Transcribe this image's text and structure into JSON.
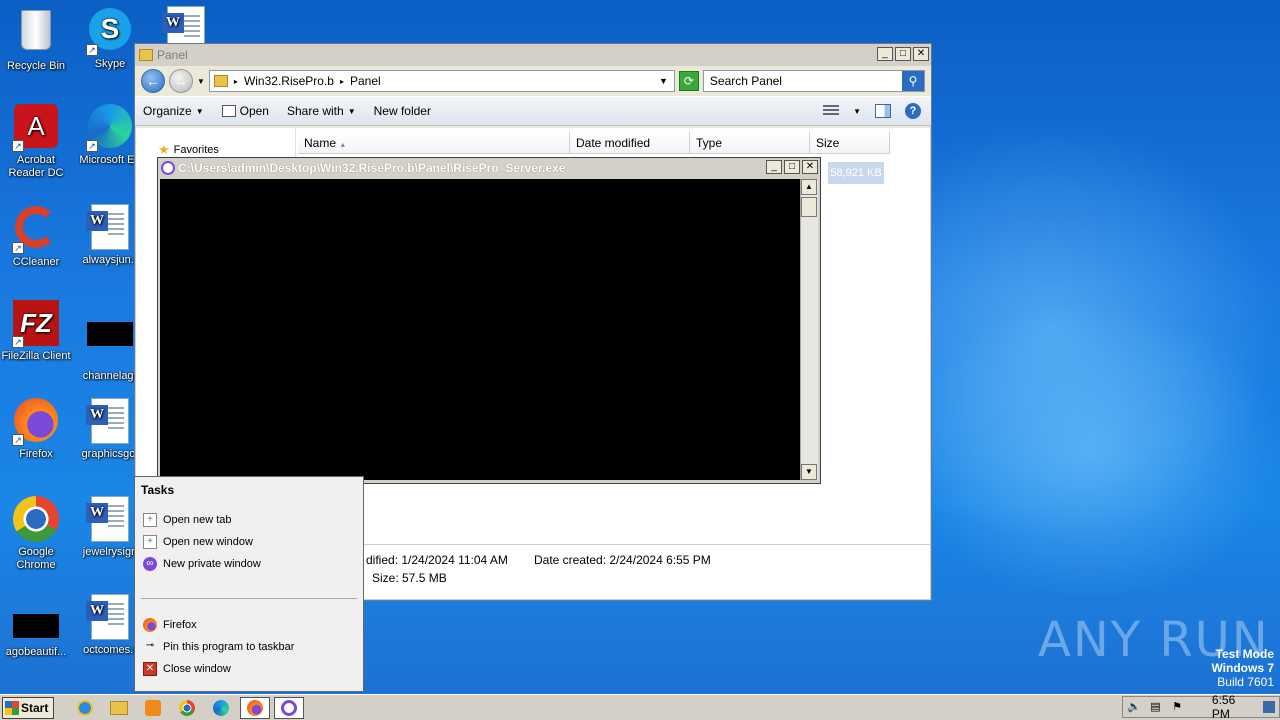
{
  "desktop": {
    "icons": [
      {
        "label": "Recycle Bin"
      },
      {
        "label": "Skype"
      },
      {
        "label": "Acrobat Reader DC"
      },
      {
        "label": "Microsoft Ed"
      },
      {
        "label": "CCleaner"
      },
      {
        "label": "alwaysjun.r"
      },
      {
        "label": "FileZilla Client"
      },
      {
        "label": "channelagr"
      },
      {
        "label": "Firefox"
      },
      {
        "label": "graphicsgot"
      },
      {
        "label": "Google Chrome"
      },
      {
        "label": "jewelrysign"
      },
      {
        "label": "agobeautif..."
      },
      {
        "label": "octcomes.r"
      }
    ]
  },
  "explorer": {
    "title": "Panel",
    "breadcrumb": [
      "Win32.RisePro.b",
      "Panel"
    ],
    "search_placeholder": "Search Panel",
    "toolbar": {
      "organize": "Organize",
      "open": "Open",
      "share_with": "Share with",
      "new_folder": "New folder"
    },
    "nav": {
      "favorites": "Favorites"
    },
    "columns": [
      "Name",
      "Date modified",
      "Type",
      "Size"
    ],
    "selected_size": "58,921 KB",
    "details": {
      "modified": "dified:  1/24/2024 11:04 AM",
      "created": "Date created:  2/24/2024 6:55 PM",
      "size": "Size:  57.5 MB"
    }
  },
  "console": {
    "title": "C:\\Users\\admin\\Desktop\\Win32.RisePro.b\\Panel\\RisePro_Server.exe"
  },
  "jumplist": {
    "header": "Tasks",
    "tasks": [
      "Open new tab",
      "Open new window",
      "New private window"
    ],
    "program": "Firefox",
    "pin": "Pin this program to taskbar",
    "close": "Close window"
  },
  "watermark": {
    "brand": "ANY RUN",
    "mode": "Test Mode",
    "os": "Windows 7",
    "build": "Build 7601"
  },
  "taskbar": {
    "start": "Start",
    "clock": "6:56 PM"
  },
  "colors": {
    "desktop_blue": "#1a7ae0",
    "console_bg": "#000000",
    "firefox_purple": "#7a4ad8"
  }
}
